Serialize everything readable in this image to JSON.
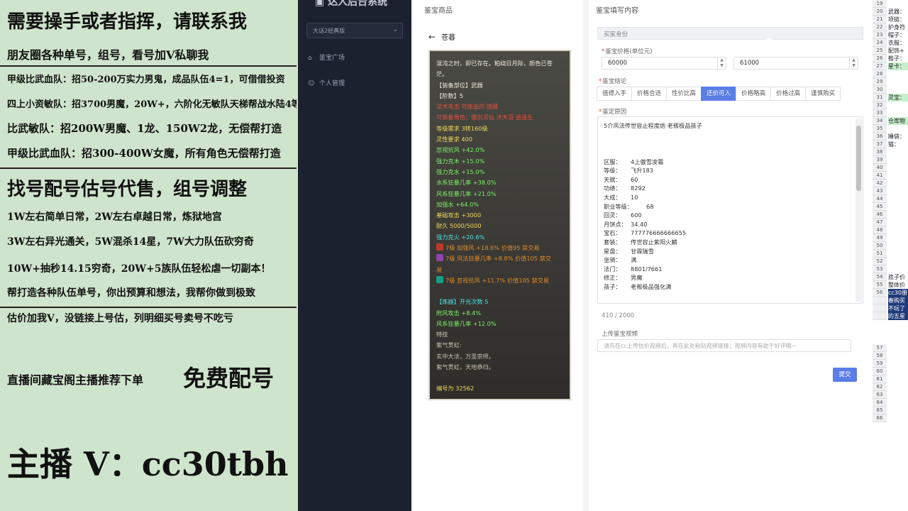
{
  "ad": {
    "lines": [
      {
        "text": "需要操手或者指挥，请联系我",
        "size": 26,
        "bold": true
      },
      {
        "text": "朋友圈各种单号，组号，看号加V私聊我",
        "size": 16,
        "bold": true
      },
      {
        "text": "甲级比武血队：招50-200万实力男鬼，成品队伍4=1，可借借投资",
        "size": 13,
        "bold": true
      },
      {
        "text": "四上小资敏队：招3700男魔，20W+，六阶化无敏队天梯帮战水陆4等1",
        "size": 13,
        "bold": true
      },
      {
        "text": "比武敏队：招200W男魔、1龙、150W2龙，无偿帮打造",
        "size": 15,
        "bold": true
      },
      {
        "text": "甲级比武血队：招300-400W女魔，所有角色无偿帮打造",
        "size": 15,
        "bold": true
      },
      {
        "text": "找号配号估号代售，组号调整",
        "size": 26,
        "bold": true
      },
      {
        "text": "1W左右简单日常，2W左右卓越日常，炼狱地宫",
        "size": 14,
        "bold": true
      },
      {
        "text": "3W左右异光通关，5W混杀14星，7W大力队伍砍穷奇",
        "size": 14,
        "bold": true
      },
      {
        "text": "10W+抽秒14.15穷奇，20W+5族队伍轻松虐一切副本！",
        "size": 14,
        "bold": true
      },
      {
        "text": "帮打造各种队伍单号，你出预算和想法，我帮你做到极致",
        "size": 14,
        "bold": true
      },
      {
        "text": "估价加我V，没链接上号估，列明细买号卖号不吃亏",
        "size": 14,
        "bold": true
      },
      {
        "text": "直播间藏宝阁主播推荐下单",
        "size": 16,
        "bold": true
      },
      {
        "text": "免费配号",
        "size": 32,
        "bold": true
      },
      {
        "text": "主播 V：cc30tbh",
        "size": 46,
        "bold": true
      }
    ]
  },
  "sidebar": {
    "brand": "达人后台系统",
    "select_value": "大话2经典版",
    "nav": [
      {
        "label": "鉴宝广场",
        "icon": "bank-icon"
      },
      {
        "label": "个人管理",
        "icon": "user-icon"
      }
    ]
  },
  "left_col": {
    "header": "鉴宝商品",
    "back_label": "苍暮"
  },
  "item_card": {
    "lines": [
      {
        "t": "混沌之时，即已存在。粕绕日月际，颜色已苍",
        "c": "w"
      },
      {
        "t": "茫。",
        "c": "w"
      },
      {
        "t": "【装备部位】武器",
        "c": "w"
      },
      {
        "t": "【阶数】5",
        "c": "w"
      },
      {
        "t": "法术攻击   可炼造的   隐藏",
        "c": "r"
      },
      {
        "t": "可装备角色：傲剑灵仙 沐天羽 逍遥生",
        "c": "r"
      },
      {
        "t": "等级需求 3转160级",
        "c": "y"
      },
      {
        "t": "灵性要求 400",
        "c": "y"
      },
      {
        "t": "忽视抗风 +42.0%",
        "c": "g"
      },
      {
        "t": "强力克木 +15.0%",
        "c": "g"
      },
      {
        "t": "强力克水 +15.0%",
        "c": "g"
      },
      {
        "t": "水系狂暴几率 +38.0%",
        "c": "g"
      },
      {
        "t": "风系狂暴几率 +21.0%",
        "c": "g"
      },
      {
        "t": "加强水 +64.0%",
        "c": "g"
      },
      {
        "t": "基础攻击 +3000",
        "c": "y"
      },
      {
        "t": "耐久 5000/5000",
        "c": "y"
      },
      {
        "t": "强力克火 +20.6%",
        "c": "c"
      },
      {
        "t": "7级 加强风 +18.6% 价值95 禁交易",
        "c": "o",
        "gem": "#c0392b"
      },
      {
        "t": "7级 风法狂暴几率 +8.8% 价值105 禁交",
        "c": "o",
        "gem": "#8e44ad"
      },
      {
        "t": "易",
        "c": "o"
      },
      {
        "t": "7级 忽视抗风 +11.7% 价值105 禁交易",
        "c": "o",
        "gem": "#16a085"
      },
      {
        "t": "",
        "c": "w"
      },
      {
        "t": "【炼器】开光次数 5",
        "c": "c"
      },
      {
        "t": "附风攻击 +8.4%",
        "c": "g"
      },
      {
        "t": "风系狂暴几率 +12.0%",
        "c": "g"
      },
      {
        "t": "特技",
        "c": "gr"
      },
      {
        "t": "紫气贯虹:",
        "c": "gr"
      },
      {
        "t": "玄中大法，万圣宗师。",
        "c": "gr"
      },
      {
        "t": "紫气贯虹，天地恭归。",
        "c": "gr"
      },
      {
        "t": "",
        "c": "w"
      },
      {
        "t": "编号为 32562",
        "c": "y"
      }
    ]
  },
  "form": {
    "header": "鉴宝填写内容",
    "buyer_label": "买家身份",
    "price_label": "鉴宝价格(单位元)",
    "price_min": "60000",
    "price_max": "61000",
    "verdict_label": "鉴宝结论",
    "tags": [
      {
        "label": "值得入手",
        "on": false
      },
      {
        "label": "价格合适",
        "on": false
      },
      {
        "label": "性价比高",
        "on": false
      },
      {
        "label": "还价可入",
        "on": true
      },
      {
        "label": "价格略高",
        "on": false
      },
      {
        "label": "价格过高",
        "on": false
      },
      {
        "label": "谨慎购买",
        "on": false
      }
    ],
    "reason_label": "鉴定原因",
    "reason_first": "5介风法传世容止程度炮 老叛极品孩子",
    "reason_rows": [
      {
        "k": "区服：",
        "v": "4上傲雪凌霜"
      },
      {
        "k": "等级：",
        "v": "飞升183"
      },
      {
        "k": "天赋：",
        "v": "60"
      },
      {
        "k": "功绩：",
        "v": "8292"
      },
      {
        "k": "大成：",
        "v": "10"
      },
      {
        "k": "职业等级：",
        "v": "68"
      },
      {
        "k": "回灵：",
        "v": "600"
      },
      {
        "k": "月饼点：",
        "v": "34.40"
      },
      {
        "k": "宝石：",
        "v": "777776666666655"
      },
      {
        "k": "套装：",
        "v": "传世容止紫阳火麟"
      },
      {
        "k": "星盘：",
        "v": "甘霖瑞雪"
      },
      {
        "k": "坐骑：",
        "v": "满"
      },
      {
        "k": "法门：",
        "v": "8801/7661"
      },
      {
        "k": "修正：",
        "v": "男魔"
      },
      {
        "k": "孩子：",
        "v": "老叛极品强化满"
      }
    ],
    "count": "410 / 2000",
    "video_label": "上传鉴宝视频",
    "video_placeholder": "请先在cc上传估价视频后，再在此处粘贴视频链接；视频内容有助于好评哦~",
    "submit_label": "提交"
  },
  "watermark": "CC直播",
  "sheet": {
    "rows": [
      {
        "n": "19",
        "t": ""
      },
      {
        "n": "20",
        "t": "武器："
      },
      {
        "n": "21",
        "t": "项链："
      },
      {
        "n": "22",
        "t": "护身符"
      },
      {
        "n": "23",
        "t": "帽子："
      },
      {
        "n": "24",
        "t": "衣服："
      },
      {
        "n": "25",
        "t": "配饰+"
      },
      {
        "n": "26",
        "t": "鞋子："
      },
      {
        "n": "27",
        "t": "星卡：",
        "hl": "g"
      },
      {
        "n": "28",
        "t": ""
      },
      {
        "n": "29",
        "t": ""
      },
      {
        "n": "30",
        "t": ""
      },
      {
        "n": "31",
        "t": "灵宝：",
        "hl": "g"
      },
      {
        "n": "32",
        "t": ""
      },
      {
        "n": "33",
        "t": ""
      },
      {
        "n": "34",
        "t": "仓库物",
        "hl": "g"
      },
      {
        "n": "35",
        "t": ""
      },
      {
        "n": "36",
        "t": "睡袋："
      },
      {
        "n": "37",
        "t": "猫："
      },
      {
        "n": "38",
        "t": ""
      },
      {
        "n": "39",
        "t": ""
      },
      {
        "n": "40",
        "t": ""
      },
      {
        "n": "41",
        "t": ""
      },
      {
        "n": "42",
        "t": ""
      },
      {
        "n": "43",
        "t": ""
      },
      {
        "n": "44",
        "t": ""
      },
      {
        "n": "45",
        "t": ""
      },
      {
        "n": "46",
        "t": ""
      },
      {
        "n": "47",
        "t": ""
      },
      {
        "n": "48",
        "t": ""
      },
      {
        "n": "49",
        "t": ""
      },
      {
        "n": "50",
        "t": ""
      },
      {
        "n": "51",
        "t": ""
      },
      {
        "n": "52",
        "t": ""
      },
      {
        "n": "53",
        "t": ""
      },
      {
        "n": "54",
        "t": "底子价"
      },
      {
        "n": "55",
        "t": "整体价"
      },
      {
        "n": "56",
        "t": "cc30册",
        "hl": "b"
      },
      {
        "n": "",
        "t": "春购买",
        "hl": "b"
      },
      {
        "n": "",
        "t": "不玩了",
        "hl": "b"
      },
      {
        "n": "",
        "t": "的五星",
        "hl": "b"
      }
    ],
    "tail": [
      "57",
      "58",
      "59",
      "60",
      "61",
      "62",
      "63",
      "64",
      "65",
      "66"
    ]
  }
}
